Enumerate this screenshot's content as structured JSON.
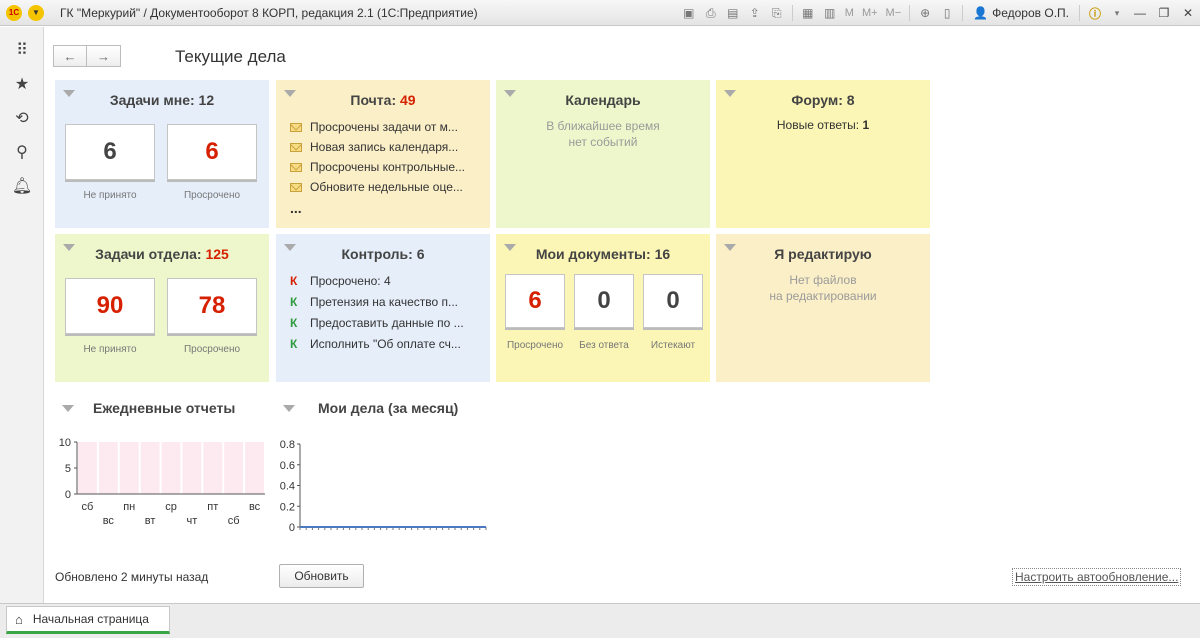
{
  "window": {
    "title": "ГК \"Меркурий\" / Документооборот 8 КОРП, редакция 2.1  (1С:Предприятие)",
    "logo": "1С",
    "user": "Федоров О.П.",
    "toolbar_text": [
      "M",
      "M+",
      "M−"
    ]
  },
  "page": {
    "title": "Текущие дела"
  },
  "tiles": {
    "tasks_me": {
      "label": "Задачи мне: 12",
      "count1": "6",
      "label1": "Не принято",
      "count2": "6",
      "label2": "Просрочено"
    },
    "mail": {
      "label": "Почта: ",
      "count": "49",
      "items": [
        "Просрочены задачи от м...",
        "Новая запись календаря...",
        "Просрочены контрольные...",
        "Обновите недельные оце..."
      ],
      "more": "..."
    },
    "calendar": {
      "label": "Календарь",
      "empty1": "В ближайшее время",
      "empty2": "нет событий"
    },
    "forum": {
      "label": "Форум: 8",
      "new_label": "Новые ответы: ",
      "new_count": "1"
    },
    "tasks_dept": {
      "label": "Задачи отдела: ",
      "count": "125",
      "count1": "90",
      "label1": "Не принято",
      "count2": "78",
      "label2": "Просрочено"
    },
    "control": {
      "label": "Контроль: 6",
      "items": [
        {
          "mark": "К",
          "text": "Просрочено: 4",
          "color": "#d62000"
        },
        {
          "mark": "К",
          "text": "Претензия на качество п...",
          "color": "#2e9b3e"
        },
        {
          "mark": "К",
          "text": "Предоставить данные по ...",
          "color": "#2e9b3e"
        },
        {
          "mark": "К",
          "text": "Исполнить \"Об оплате сч...",
          "color": "#2e9b3e"
        }
      ]
    },
    "my_docs": {
      "label": "Мои документы: 16",
      "c1": "6",
      "l1": "Просрочено",
      "c2": "0",
      "l2": "Без ответа",
      "c3": "0",
      "l3": "Истекают"
    },
    "editing": {
      "label": "Я редактирую",
      "empty1": "Нет файлов",
      "empty2": "на редактировании"
    }
  },
  "chart_data": [
    {
      "type": "bar",
      "title": "Ежедневные отчеты",
      "categories": [
        "сб",
        "вс",
        "пн",
        "вт",
        "ср",
        "чт",
        "пт",
        "сб",
        "вс"
      ],
      "values": [
        0,
        0,
        0,
        0,
        0,
        0,
        0,
        0,
        0
      ],
      "yticks": [
        0,
        5,
        10
      ],
      "ylim": [
        0,
        10
      ],
      "xlabel": "",
      "ylabel": ""
    },
    {
      "type": "line",
      "title": "Мои дела (за месяц)",
      "yticks": [
        0,
        0.2,
        0.4,
        0.6,
        0.8
      ],
      "ylim": [
        0,
        0.8
      ],
      "values": [
        0,
        0,
        0,
        0,
        0,
        0,
        0,
        0,
        0,
        0,
        0,
        0,
        0,
        0,
        0,
        0,
        0,
        0,
        0,
        0,
        0,
        0,
        0,
        0,
        0,
        0,
        0,
        0,
        0,
        0,
        0
      ],
      "xlabel": "",
      "ylabel": ""
    }
  ],
  "footer": {
    "updated": "Обновлено 2 минуты назад",
    "refresh_label": "Обновить",
    "autoupdate_label": "Настроить автообновление..."
  },
  "bottom": {
    "home_tab": "Начальная страница"
  },
  "colors": {
    "blue_tile": "#e6eefa",
    "orange_tile": "#fbefc8",
    "green_tile": "#eef7cc",
    "yellow_tile": "#fbf6b6",
    "accent_green": "#3aa544",
    "alert_red": "#d62000"
  }
}
